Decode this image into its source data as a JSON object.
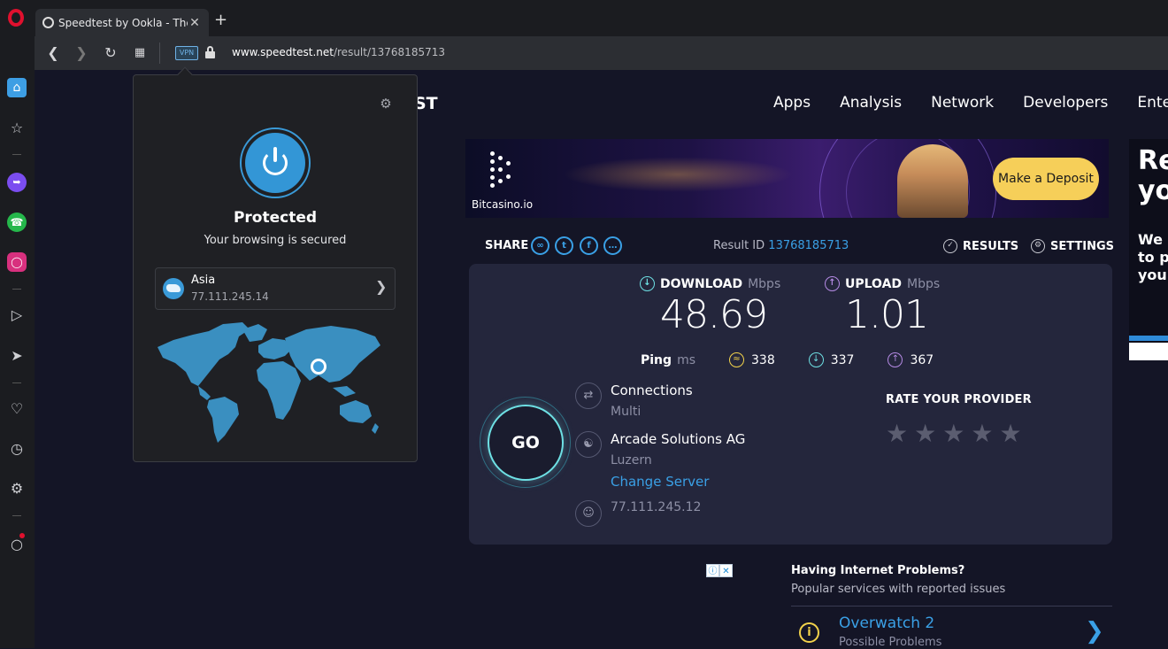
{
  "browser": {
    "tab_title": "Speedtest by Ookla - The G",
    "tab_close": "✕",
    "new_tab": "+",
    "vpn_badge": "VPN",
    "url_domain": "www.speedtest.net",
    "url_path": "/result/13768185713"
  },
  "vpn_popup": {
    "status": "Protected",
    "subtitle": "Your browsing is secured",
    "location": "Asia",
    "ip": "77.111.245.14"
  },
  "header": {
    "logo_fragment": "ST",
    "nav": [
      "Apps",
      "Analysis",
      "Network",
      "Developers",
      "Ente"
    ]
  },
  "banner": {
    "brand": "Bitcasino.io",
    "cta": "Make a Deposit"
  },
  "share_row": {
    "share_label": "SHARE",
    "result_label": "Result ID",
    "result_id": "13768185713",
    "results_label": "RESULTS",
    "settings_label": "SETTINGS"
  },
  "result": {
    "download_label": "DOWNLOAD",
    "upload_label": "UPLOAD",
    "unit": "Mbps",
    "download_value": "48.69",
    "upload_value": "1.01",
    "ping_label": "Ping",
    "ping_unit": "ms",
    "ping_idle": "338",
    "ping_download": "337",
    "ping_upload": "367",
    "go_label": "GO",
    "connections_title": "Connections",
    "connections_value": "Multi",
    "server_name": "Arcade Solutions AG",
    "server_location": "Luzern",
    "change_server": "Change Server",
    "client_ip": "77.111.245.12",
    "rate_label": "RATE YOUR PROVIDER",
    "rating": 0,
    "rating_max": 5
  },
  "issues": {
    "title": "Having Internet Problems?",
    "subtitle": "Popular services with reported issues",
    "item_title": "Overwatch 2",
    "item_sub": "Possible Problems"
  },
  "side_ad": {
    "line1": "Re\nyo",
    "line2": "We a\nto p\nyour"
  },
  "colors": {
    "accent": "#3aa0e6",
    "download": "#6ee0e4",
    "upload": "#b48ae4",
    "idle": "#f2d24b",
    "vpn_blue": "#3396d6"
  },
  "icons": {
    "sidebar": [
      "home-icon",
      "star-icon",
      "messenger-icon",
      "whatsapp-icon",
      "instagram-icon",
      "play-icon",
      "send-icon",
      "heart-icon",
      "history-icon",
      "gear-icon",
      "lightbulb-icon"
    ]
  }
}
